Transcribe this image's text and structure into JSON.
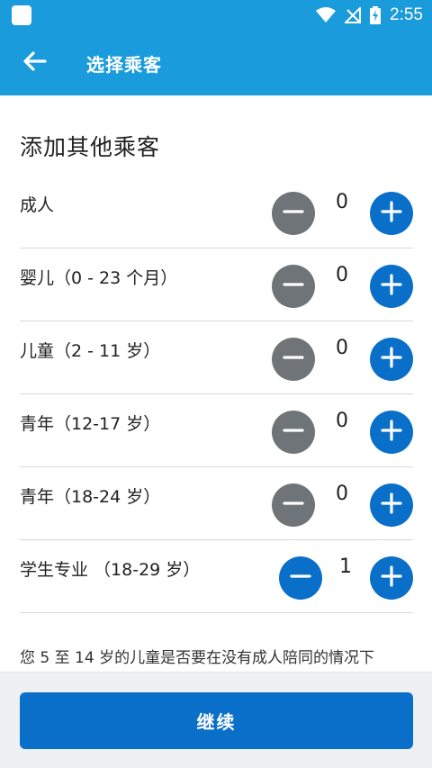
{
  "status_bar": {
    "time": "2:55"
  },
  "app_bar": {
    "title": "选择乘客"
  },
  "section": {
    "title": "添加其他乘客"
  },
  "passengers": [
    {
      "label": "成人",
      "count": "0"
    },
    {
      "label": "婴儿（0 - 23 个月）",
      "count": "0"
    },
    {
      "label": "儿童（2 - 11 岁）",
      "count": "0"
    },
    {
      "label": "青年（12-17 岁）",
      "count": "0"
    },
    {
      "label": "青年（18-24 岁）",
      "count": "0"
    },
    {
      "label": "学生专业 （18-29 岁）",
      "count": "1"
    }
  ],
  "notice": "您 5 至 14 岁的儿童是否要在没有成人陪同的情况下",
  "footer": {
    "continue_label": "继续"
  },
  "colors": {
    "header": "#1a9bdb",
    "primary": "#0a6fc8",
    "disabled": "#6e7478"
  }
}
